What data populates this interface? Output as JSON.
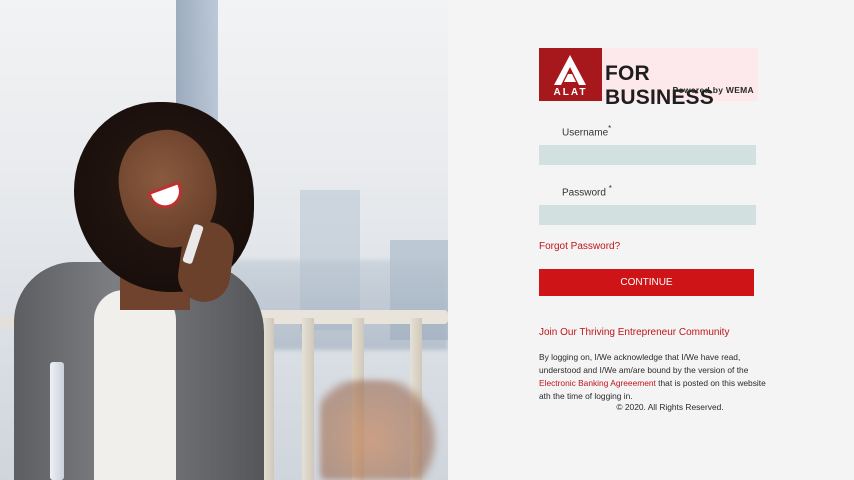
{
  "brand": {
    "logo_mark_text": "ALAT",
    "title": "FOR BUSINESS",
    "subtitle": "Powered by WEMA",
    "accent_color": "#cf1417"
  },
  "form": {
    "username_label": "Username",
    "password_label": "Password",
    "required_marker": "*",
    "username_value": "",
    "password_value": "",
    "forgot_password": "Forgot Password?",
    "continue_button": "CONTINUE"
  },
  "footer": {
    "join_link": "Join Our Thriving Entrepreneur Community",
    "disclaimer_before": "By logging on, I/We acknowledge that I/We have read, understood and I/We am/are bound by the version of the ",
    "disclaimer_link": "Electronic Banking Agreeement",
    "disclaimer_after": " that is posted on this website ath the time of logging in.",
    "copyright": "© 2020. All Rights Reserved."
  }
}
